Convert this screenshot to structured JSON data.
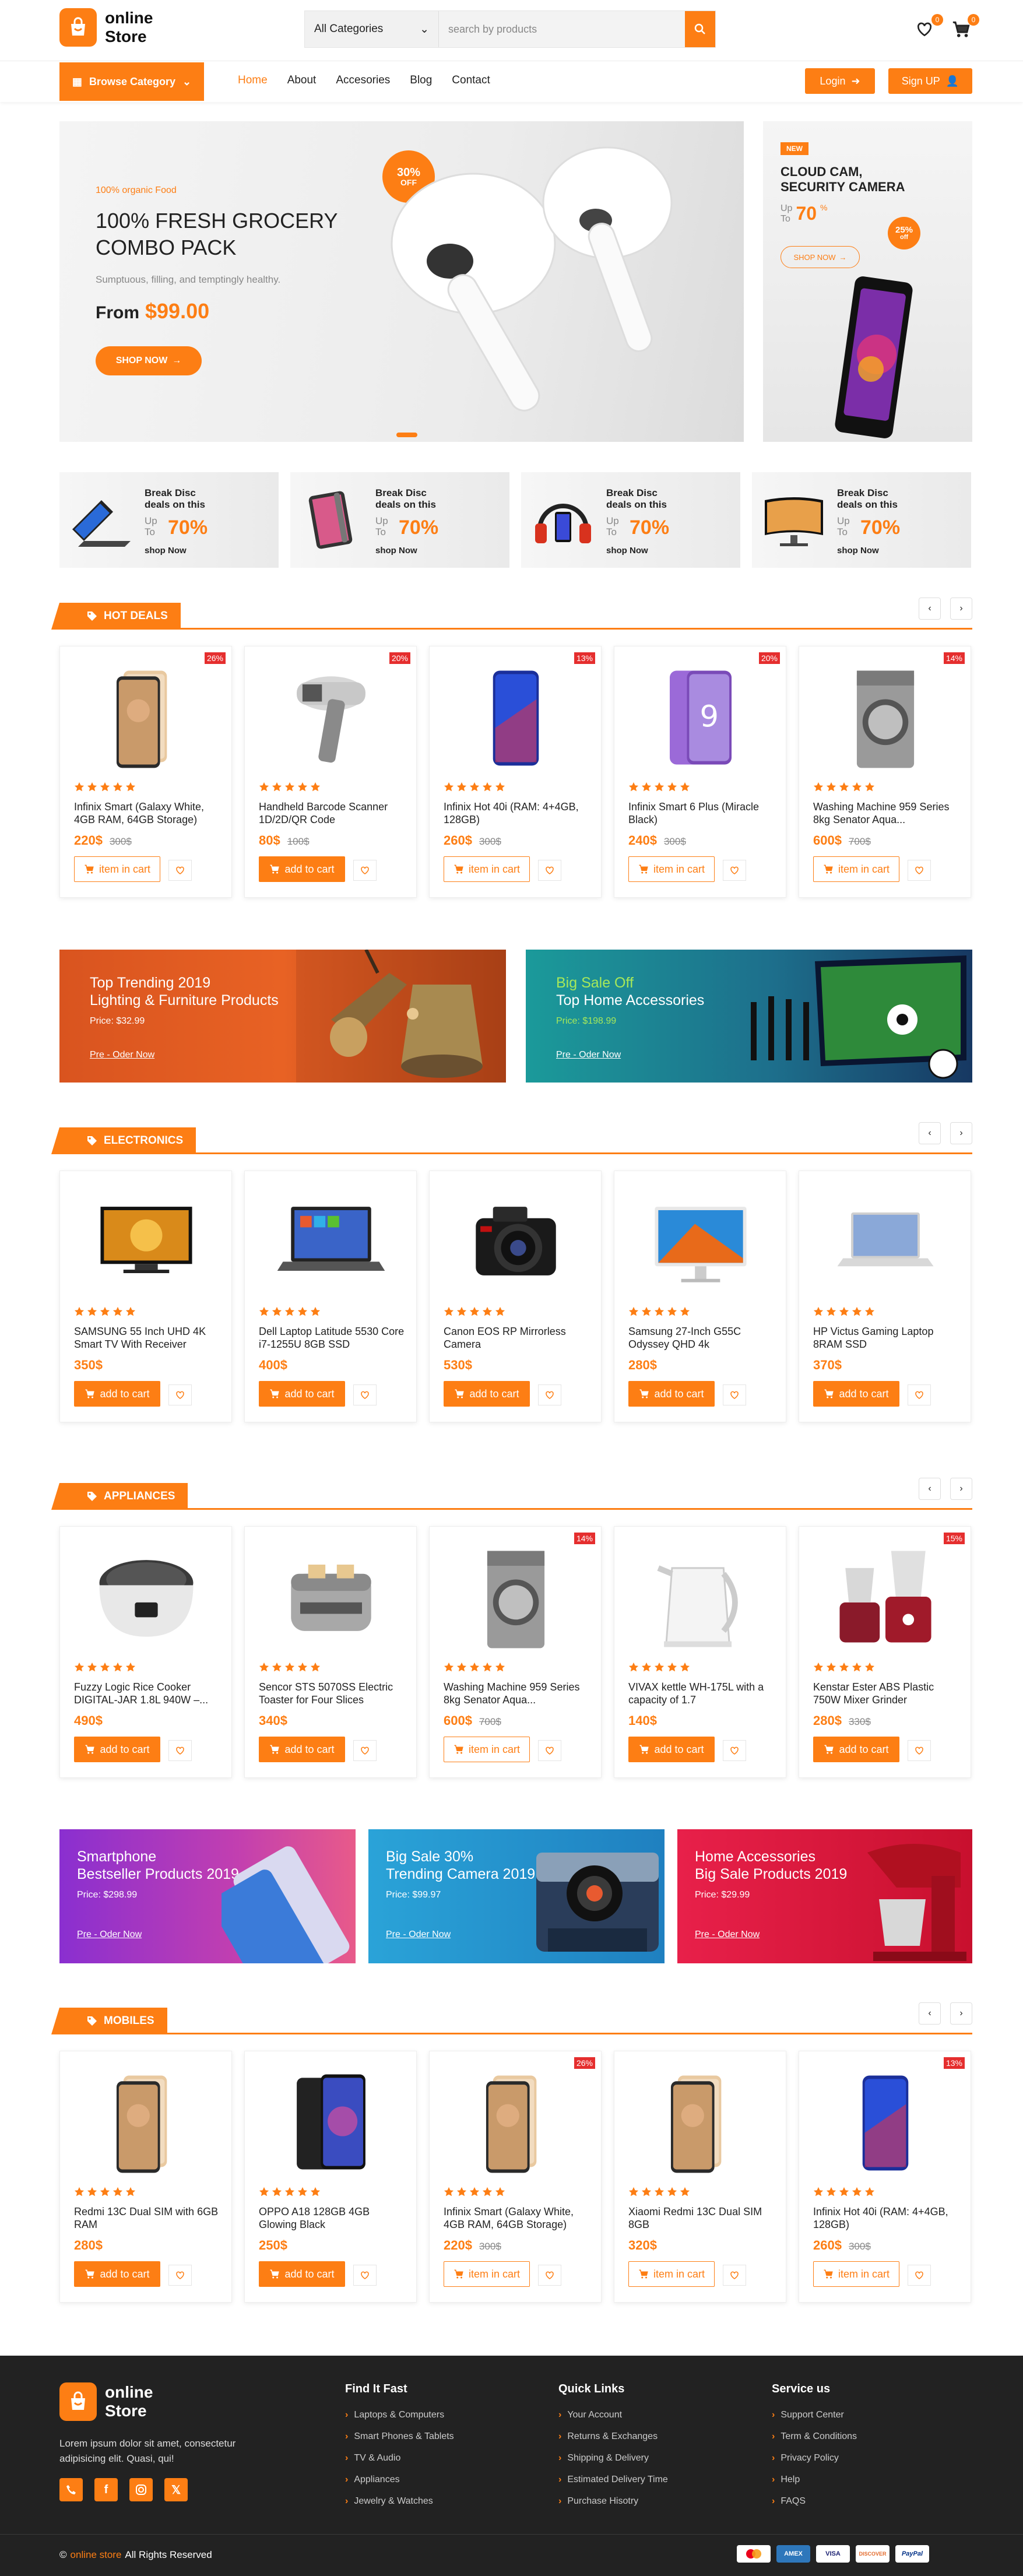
{
  "brand": {
    "name_line1": "online",
    "name_line2": "Store"
  },
  "colors": {
    "accent": "#fd7e14",
    "sale_badge": "#e52e2e",
    "footer_bg": "#222222"
  },
  "search": {
    "category": "All Categories",
    "placeholder": "search by products"
  },
  "header_icons": {
    "wishlist_count": "0",
    "cart_count": "0"
  },
  "nav": {
    "browse": "Browse Category",
    "links": [
      "Home",
      "About",
      "Accesories",
      "Blog",
      "Contact"
    ],
    "active": "Home",
    "login": "Login",
    "signup": "Sign UP"
  },
  "hero": {
    "kicker": "100% organic Food",
    "title_line1": "100% FRESH GROCERY",
    "title_line2": "COMBO PACK",
    "subtitle": "Sumptuous, filling, and temptingly healthy.",
    "price_prefix": "From",
    "price": "$99.00",
    "button": "SHOP NOW",
    "seal_pct": "30%",
    "seal_off": "OFF"
  },
  "hero_side": {
    "badge": "NEW",
    "title_line1": "CLOUD CAM,",
    "title_line2": "SECURITY CAMERA",
    "up": "Up",
    "to": "To",
    "pct": "70",
    "pct_sign": "%",
    "button": "SHOP NOW",
    "seal_pct": "25%",
    "seal_off": "off"
  },
  "promo_boxes": [
    {
      "title_line1": "Break Disc",
      "title_line2": "deals on this",
      "up": "Up",
      "to": "To",
      "pct": "70%",
      "link": "shop Now",
      "icon": "laptop-2in1"
    },
    {
      "title_line1": "Break Disc",
      "title_line2": "deals on this",
      "up": "Up",
      "to": "To",
      "pct": "70%",
      "link": "shop Now",
      "icon": "tablet"
    },
    {
      "title_line1": "Break Disc",
      "title_line2": "deals on this",
      "up": "Up",
      "to": "To",
      "pct": "70%",
      "link": "shop Now",
      "icon": "headphones-phone"
    },
    {
      "title_line1": "Break Disc",
      "title_line2": "deals on this",
      "up": "Up",
      "to": "To",
      "pct": "70%",
      "link": "shop Now",
      "icon": "curved-monitor"
    }
  ],
  "sections": [
    {
      "title": "HOT DEALS",
      "products": [
        {
          "discount": "26%",
          "name": "Infinix Smart (Galaxy White, 4GB RAM, 64GB Storage)",
          "price": "220$",
          "old": "300$",
          "cart": "item in cart",
          "icon": "phone-gold"
        },
        {
          "discount": "20%",
          "name": "Handheld Barcode Scanner 1D/2D/QR Code",
          "price": "80$",
          "old": "100$",
          "cart": "add to cart",
          "icon": "scanner"
        },
        {
          "discount": "13%",
          "name": "Infinix Hot 40i (RAM: 4+4GB, 128GB)",
          "price": "260$",
          "old": "300$",
          "cart": "item in cart",
          "icon": "phone-blue"
        },
        {
          "discount": "20%",
          "name": "Infinix Smart 6 Plus (Miracle Black)",
          "price": "240$",
          "old": "300$",
          "cart": "item in cart",
          "icon": "phone-purple"
        },
        {
          "discount": "14%",
          "name": "Washing Machine 959 Series 8kg Senator Aqua...",
          "price": "600$",
          "old": "700$",
          "cart": "item in cart",
          "icon": "washer"
        }
      ]
    },
    {
      "title": "ELECTRONICS",
      "products": [
        {
          "discount": "",
          "name": "SAMSUNG 55 Inch UHD 4K Smart TV With Receiver",
          "price": "350$",
          "old": "",
          "cart": "add to cart",
          "icon": "tv"
        },
        {
          "discount": "",
          "name": "Dell Laptop Latitude 5530 Core i7-1255U 8GB SSD",
          "price": "400$",
          "old": "",
          "cart": "add to cart",
          "icon": "laptop"
        },
        {
          "discount": "",
          "name": "Canon EOS RP Mirrorless Camera",
          "price": "530$",
          "old": "",
          "cart": "add to cart",
          "icon": "camera"
        },
        {
          "discount": "",
          "name": "Samsung 27-Inch G55C Odyssey QHD 4k",
          "price": "280$",
          "old": "",
          "cart": "add to cart",
          "icon": "monitor"
        },
        {
          "discount": "",
          "name": "HP Victus Gaming Laptop 8RAM SSD",
          "price": "370$",
          "old": "",
          "cart": "add to cart",
          "icon": "macbook"
        }
      ]
    },
    {
      "title": "APPLIANCES",
      "products": [
        {
          "discount": "",
          "name": "Fuzzy Logic Rice Cooker DIGITAL-JAR 1.8L 940W –...",
          "price": "490$",
          "old": "",
          "cart": "add to cart",
          "icon": "rice-cooker"
        },
        {
          "discount": "",
          "name": "Sencor STS 5070SS Electric Toaster for Four Slices",
          "price": "340$",
          "old": "",
          "cart": "add to cart",
          "icon": "toaster"
        },
        {
          "discount": "14%",
          "name": "Washing Machine 959 Series 8kg Senator Aqua...",
          "price": "600$",
          "old": "700$",
          "cart": "item in cart",
          "icon": "washer"
        },
        {
          "discount": "",
          "name": "VIVAX kettle WH-175L with a capacity of 1.7",
          "price": "140$",
          "old": "",
          "cart": "add to cart",
          "icon": "kettle"
        },
        {
          "discount": "15%",
          "name": "Kenstar Ester ABS Plastic 750W Mixer Grinder",
          "price": "280$",
          "old": "330$",
          "cart": "add to cart",
          "icon": "mixer"
        }
      ]
    },
    {
      "title": "MOBILES",
      "products": [
        {
          "discount": "",
          "name": "Redmi 13C Dual SIM with 6GB RAM",
          "price": "280$",
          "old": "",
          "cart": "add to cart",
          "icon": "phone-gold"
        },
        {
          "discount": "",
          "name": "OPPO A18 128GB 4GB Glowing Black",
          "price": "250$",
          "old": "",
          "cart": "add to cart",
          "icon": "phone-black"
        },
        {
          "discount": "26%",
          "name": "Infinix Smart (Galaxy White, 4GB RAM, 64GB Storage)",
          "price": "220$",
          "old": "300$",
          "cart": "item in cart",
          "icon": "phone-gold"
        },
        {
          "discount": "",
          "name": "Xiaomi Redmi 13C Dual SIM 8GB",
          "price": "320$",
          "old": "",
          "cart": "item in cart",
          "icon": "phone-gold"
        },
        {
          "discount": "13%",
          "name": "Infinix Hot 40i (RAM: 4+4GB, 128GB)",
          "price": "260$",
          "old": "300$",
          "cart": "item in cart",
          "icon": "phone-blue"
        }
      ]
    }
  ],
  "banners_wide": [
    {
      "line1": "Top Trending 2019",
      "line2": "Lighting & Furniture Products",
      "price": "Price: $32.99",
      "link": "Pre - Oder Now"
    },
    {
      "line1": "Big Sale Off",
      "line2": "Top Home Accessories",
      "price": "Price: $198.99",
      "link": "Pre - Oder Now"
    }
  ],
  "banners_three": [
    {
      "line1": "Smartphone",
      "line2": "Bestseller Products 2019",
      "price": "Price: $298.99",
      "link": "Pre - Oder Now"
    },
    {
      "line1": "Big Sale 30%",
      "line2": "Trending Camera 2019",
      "price": "Price: $99.97",
      "link": "Pre - Oder Now"
    },
    {
      "line1": "Home Accessories",
      "line2": "Big Sale Products 2019",
      "price": "Price: $29.99",
      "link": "Pre - Oder Now"
    }
  ],
  "footer": {
    "about": "Lorem ipsum dolor sit amet, consectetur adipisicing elit. Quasi, qui!",
    "cols": [
      {
        "title": "Find It Fast",
        "items": [
          "Laptops & Computers",
          "Smart Phones & Tablets",
          "TV & Audio",
          "Appliances",
          "Jewelry & Watches"
        ]
      },
      {
        "title": "Quick Links",
        "items": [
          "Your Account",
          "Returns & Exchanges",
          "Shipping & Delivery",
          "Estimated Delivery Time",
          "Purchase Hisotry"
        ]
      },
      {
        "title": "Service us",
        "items": [
          "Support Center",
          "Term & Conditions",
          "Privacy Policy",
          "Help",
          "FAQS"
        ]
      }
    ],
    "copy_symbol": "©",
    "copy_brand": "online store",
    "copy_rest": "All Rights Reserved",
    "payments": [
      "mastercard",
      "AMEX",
      "VISA",
      "DISCOVER",
      "PayPal"
    ]
  }
}
